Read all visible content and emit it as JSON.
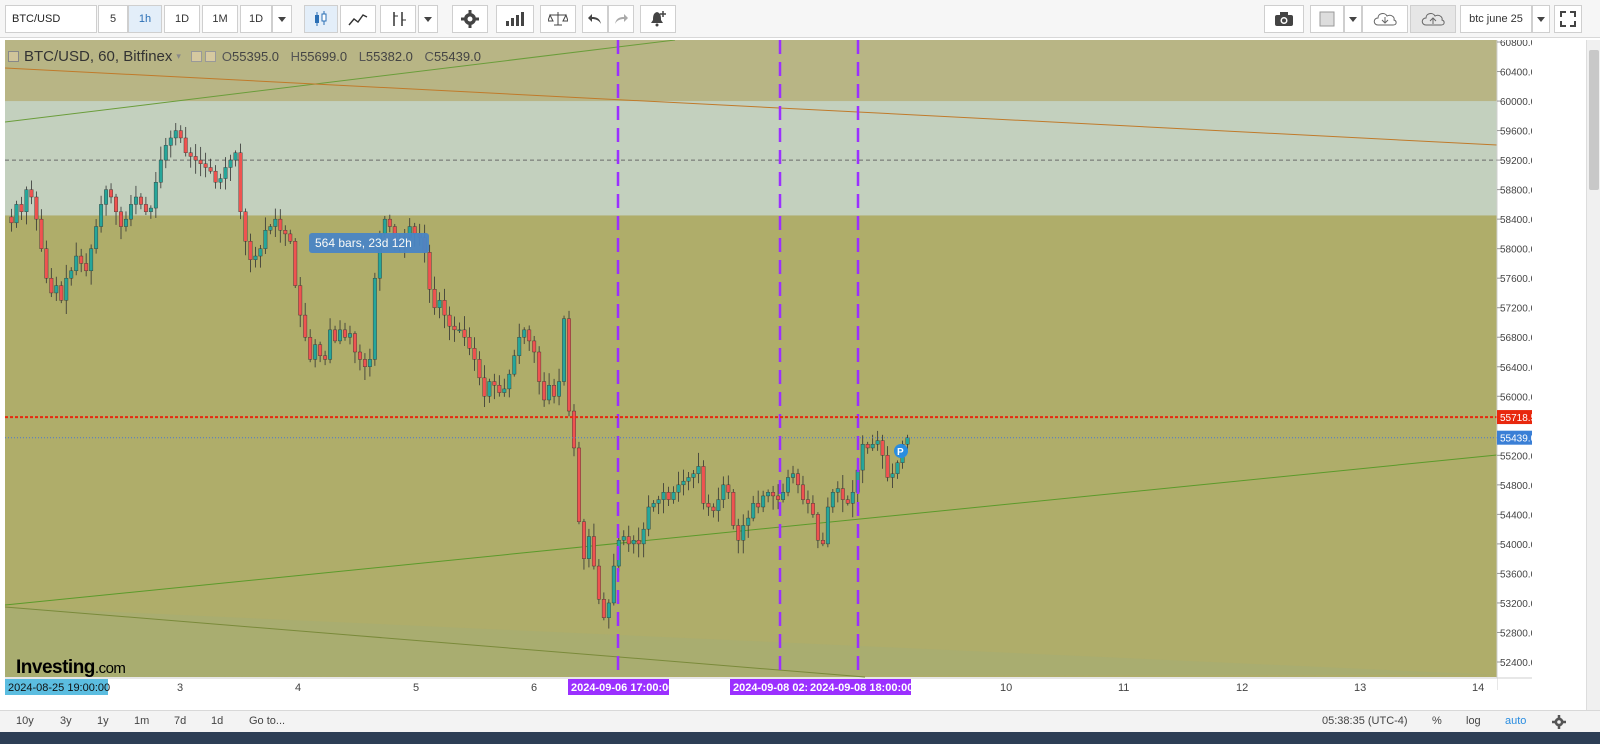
{
  "toolbar": {
    "symbol": "BTC/USD",
    "intervals": [
      "5",
      "1h",
      "1D",
      "1M",
      "1D"
    ],
    "active_interval": "1h",
    "search_value": "btc june 25"
  },
  "legend": {
    "symbol": "BTC/USD, 60, Bitfinex",
    "open_label": "O",
    "open": "55395.0",
    "high_label": "H",
    "high": "55699.0",
    "low_label": "L",
    "low": "55382.0",
    "close_label": "C",
    "close": "55439.0"
  },
  "price_axis": {
    "ticks": [
      "60800.0",
      "60400.0",
      "60000.0",
      "59600.0",
      "59200.0",
      "58800.0",
      "58400.0",
      "58000.0",
      "57600.0",
      "57200.0",
      "56800.0",
      "56400.0",
      "56000.0",
      "55200.0",
      "54800.0",
      "54400.0",
      "54000.0",
      "53600.0",
      "53200.0",
      "52800.0",
      "52400.0"
    ],
    "red_line_label": "55718.5",
    "last_price_label": "55439.0"
  },
  "time_axis": {
    "ticks": [
      "3",
      "4",
      "5",
      "6",
      "10",
      "11",
      "12",
      "13",
      "14"
    ],
    "start_label": "2024-08-25 19:00:00",
    "marker_labels": [
      "2024-09-06 17:00:00",
      "2024-09-08 02:0",
      "2024-09-08 18:00:00"
    ]
  },
  "annotations": {
    "measure_text": "564 bars, 23d 12h",
    "p_badge": "P"
  },
  "logo": {
    "name": "Investing",
    "suffix": ".com"
  },
  "bottombar": {
    "ranges": [
      "10y",
      "3y",
      "1y",
      "1m",
      "7d",
      "1d"
    ],
    "goto": "Go to...",
    "clock": "05:38:35 (UTC-4)",
    "percent": "%",
    "log": "log",
    "auto": "auto"
  },
  "colors": {
    "up": "#26a69a",
    "down": "#ef5350",
    "zone": "#afad6a",
    "top_zone": "#b8b585",
    "band": "#c5d4c8",
    "marker": "#9b30ff",
    "red_line": "#e8280e",
    "blue_line": "#4a78d0"
  },
  "chart_data": {
    "type": "candlestick",
    "x_start": "2024-08-25 19:00:00",
    "interval": "60",
    "ylim": [
      52400,
      60800
    ],
    "levels": {
      "red_dotted": 55718.5,
      "last_price": 55439.0,
      "dashed_reference": 59200
    },
    "band": [
      58450,
      60000
    ],
    "vertical_markers": [
      "2024-09-06 17:00:00",
      "2024-09-08 02:00:00",
      "2024-09-08 18:00:00"
    ],
    "closes": [
      58350,
      58600,
      58500,
      58800,
      58700,
      58400,
      58000,
      57600,
      57400,
      57500,
      57300,
      57600,
      57700,
      57900,
      57800,
      57700,
      58000,
      58300,
      58600,
      58800,
      58700,
      58500,
      58300,
      58400,
      58600,
      58700,
      58600,
      58500,
      58550,
      58900,
      59200,
      59400,
      59500,
      59600,
      59500,
      59300,
      59250,
      59200,
      59150,
      59100,
      59050,
      58900,
      58950,
      59100,
      59200,
      59300,
      58500,
      58100,
      57850,
      57900,
      58000,
      58250,
      58300,
      58400,
      58250,
      58200,
      58100,
      57500,
      57100,
      56800,
      56500,
      56700,
      56550,
      56500,
      56900,
      56750,
      56900,
      56800,
      56850,
      56600,
      56500,
      56400,
      56500,
      57600,
      58200,
      58400,
      58300,
      58100,
      58050,
      58150,
      58300,
      58200,
      58150,
      57950,
      57450,
      57200,
      57300,
      57100,
      56950,
      56900,
      56900,
      56800,
      56650,
      56500,
      56250,
      56000,
      56200,
      56150,
      56050,
      56100,
      56300,
      56550,
      56800,
      56900,
      56750,
      56600,
      56200,
      55950,
      56150,
      56000,
      56200,
      57050,
      55800,
      55300,
      54300,
      53800,
      54100,
      53700,
      53250,
      53000,
      53200,
      53700,
      54050,
      54100,
      54000,
      54050,
      54000,
      54200,
      54500,
      54550,
      54600,
      54700,
      54600,
      54700,
      54800,
      54850,
      54900,
      54950,
      55050,
      54550,
      54500,
      54450,
      54600,
      54800,
      54700,
      54250,
      54050,
      54250,
      54350,
      54550,
      54500,
      54650,
      54700,
      54650,
      54600,
      54700,
      54900,
      54950,
      54800,
      54600,
      54550,
      54400,
      54050,
      54000,
      54500,
      54700,
      54750,
      54600,
      54550,
      54700,
      55000,
      55350,
      55300,
      55350,
      55400,
      55200,
      54900,
      54950,
      55100,
      55350,
      55439
    ]
  }
}
